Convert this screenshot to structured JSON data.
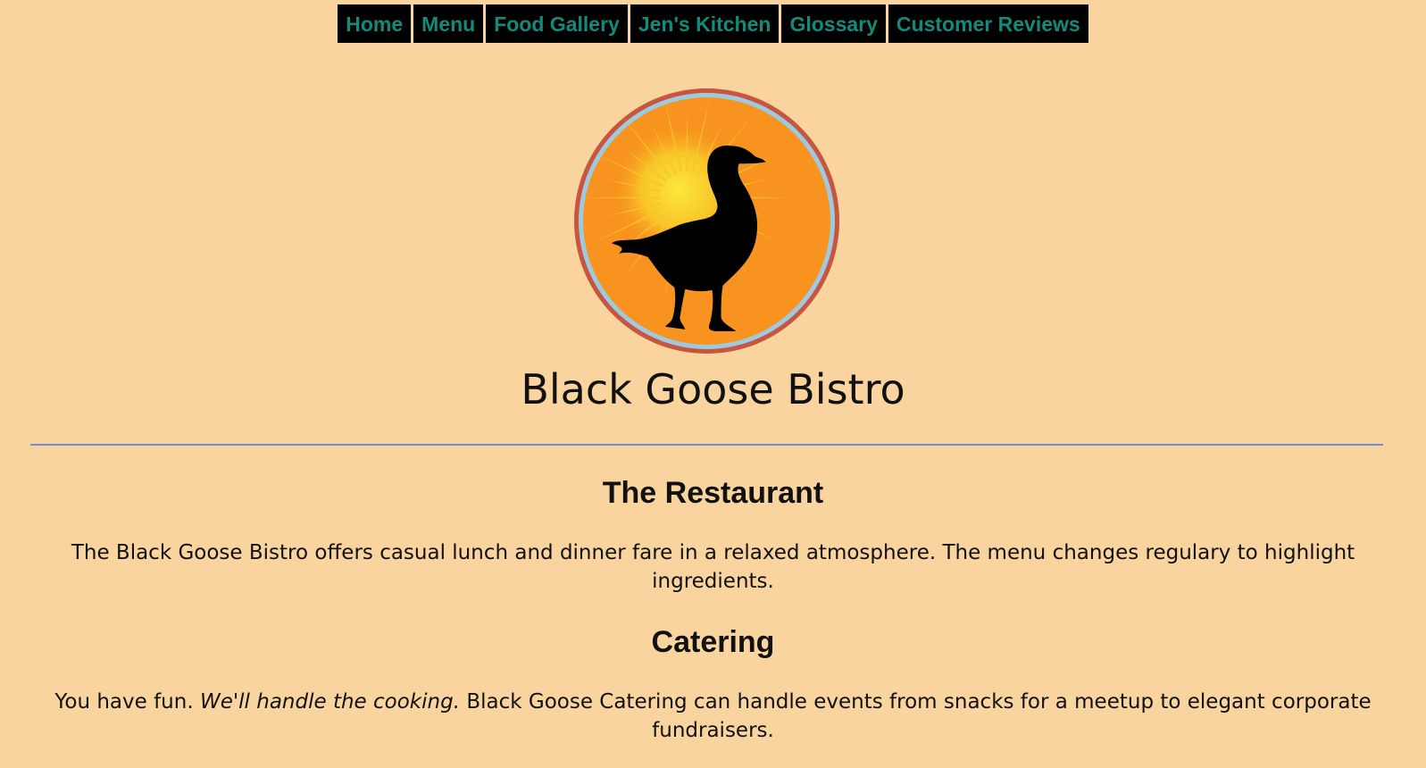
{
  "nav": {
    "items": [
      {
        "label": "Home"
      },
      {
        "label": "Menu"
      },
      {
        "label": "Food Gallery"
      },
      {
        "label": "Jen's Kitchen"
      },
      {
        "label": "Glossary"
      },
      {
        "label": "Customer Reviews"
      }
    ]
  },
  "logo": {
    "icon": "goose-silhouette-sunburst-icon"
  },
  "site": {
    "title": "Black Goose Bistro"
  },
  "restaurant": {
    "heading": "The Restaurant",
    "text": "The Black Goose Bistro offers casual lunch and dinner fare in a relaxed atmosphere. The menu changes regulary to highlight ingredients."
  },
  "catering": {
    "heading": "Catering",
    "text_start": "You have fun. ",
    "text_emphasis": "We'll handle the cooking.",
    "text_end": " Black Goose Catering can handle events from snacks for a meetup to elegant corporate fundraisers."
  },
  "colors": {
    "page_background": "#fad49f",
    "nav_background": "#000000",
    "nav_text": "#138a7c",
    "divider": "#6f8fcf",
    "logo_orange": "#f7931e",
    "logo_ring_outer": "#c8553d",
    "logo_ring_inner": "#9ecae1",
    "logo_sun_yellow": "#f8e030"
  }
}
